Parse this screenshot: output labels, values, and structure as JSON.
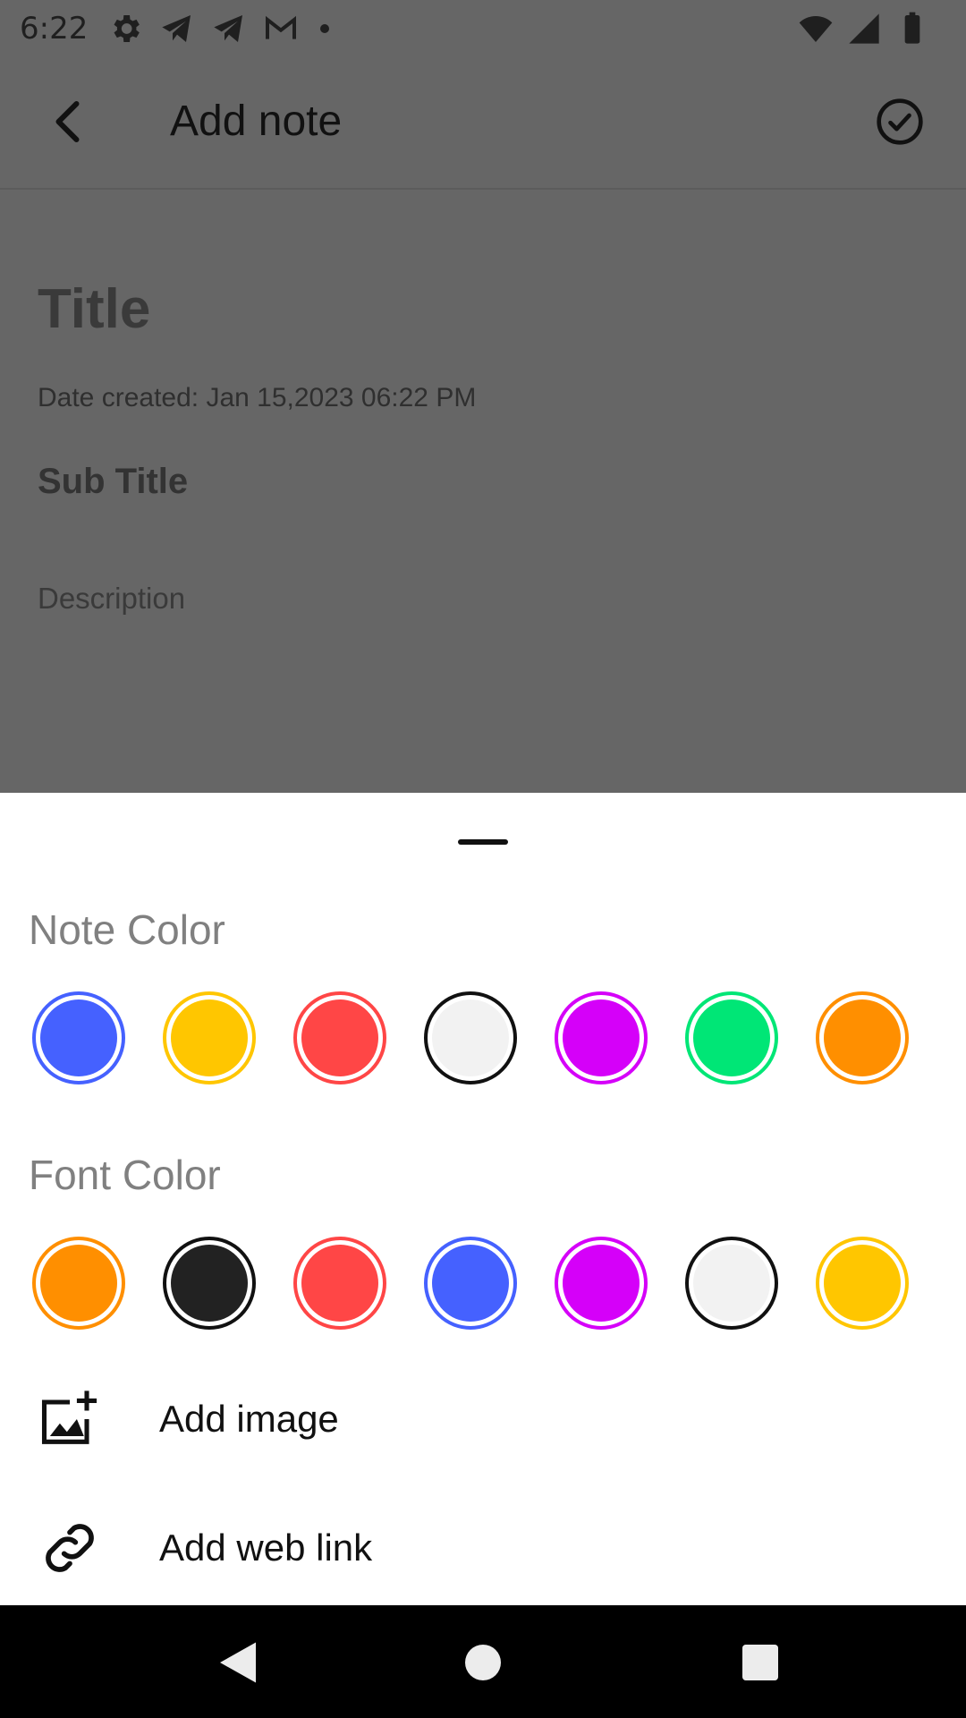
{
  "status_bar": {
    "time": "6:22",
    "left_icons": [
      "settings-icon",
      "telegram-icon",
      "telegram-icon",
      "gmail-icon",
      "dot-icon"
    ],
    "right_icons": [
      "wifi-icon",
      "signal-icon",
      "battery-icon"
    ]
  },
  "app_bar": {
    "title": "Add note",
    "back_icon": "back-arrow-icon",
    "save_icon": "check-circle-icon"
  },
  "form": {
    "title_placeholder": "Title",
    "date_created": "Date created: Jan 15,2023  06:22 PM",
    "subtitle_placeholder": "Sub Title",
    "description_placeholder": "Description"
  },
  "sheet": {
    "note_color_label": "Note Color",
    "note_colors": [
      "#4561ff",
      "#ffc600",
      "#ff4646",
      "#f2f2f2",
      "#d500f9",
      "#00e676",
      "#ff8f00"
    ],
    "note_color_rings": [
      "#4561ff",
      "#ffc600",
      "#ff4646",
      "#111111",
      "#d500f9",
      "#00e676",
      "#ff8f00"
    ],
    "font_color_label": "Font Color",
    "font_colors": [
      "#ff8f00",
      "#222222",
      "#ff4646",
      "#4561ff",
      "#d500f9",
      "#f2f2f2",
      "#ffc600"
    ],
    "font_color_rings": [
      "#ff8f00",
      "#111111",
      "#ff4646",
      "#4561ff",
      "#d500f9",
      "#111111",
      "#ffc600"
    ],
    "add_image_label": "Add image",
    "add_link_label": "Add web link"
  },
  "nav_bar": {
    "icons": [
      "nav-back-icon",
      "nav-home-icon",
      "nav-recents-icon"
    ]
  }
}
